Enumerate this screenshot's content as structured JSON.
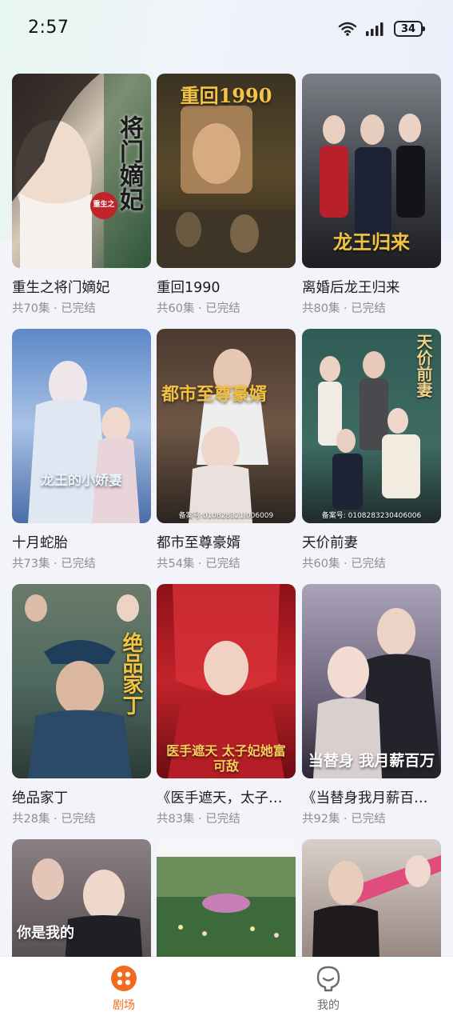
{
  "status_bar": {
    "time": "2:57",
    "battery": "34"
  },
  "dramas": [
    {
      "title": "重生之将门嫡妃",
      "episodes": "共70集",
      "status": "已完结",
      "poster_text": "将门嫡妃",
      "badge": "重生之"
    },
    {
      "title": "重回1990",
      "episodes": "共60集",
      "status": "已完结",
      "poster_text": "重回1990"
    },
    {
      "title": "离婚后龙王归来",
      "episodes": "共80集",
      "status": "已完结",
      "poster_text": "龙王归来"
    },
    {
      "title": "十月蛇胎",
      "episodes": "共73集",
      "status": "已完结",
      "poster_text": "龙王的小娇妻"
    },
    {
      "title": "都市至尊豪婿",
      "episodes": "共54集",
      "status": "已完结",
      "poster_text": "都市至尊豪婿",
      "record": "备案号:010828321l006009"
    },
    {
      "title": "天价前妻",
      "episodes": "共60集",
      "status": "已完结",
      "poster_text": "天价前妻",
      "record": "备案号: 0108283230406006"
    },
    {
      "title": "绝品家丁",
      "episodes": "共28集",
      "status": "已完结",
      "poster_text": "绝品家丁"
    },
    {
      "title": "《医手遮天，太子妃她富可敌国》",
      "episodes": "共83集",
      "status": "已完结",
      "poster_text": "医手遮天 太子妃她富可敌"
    },
    {
      "title": "《当替身我月薪百万》",
      "episodes": "共92集",
      "status": "已完结",
      "poster_text": "当替身 我月薪百万"
    },
    {
      "title": "",
      "episodes": "",
      "status": "",
      "poster_text": "你是我的"
    },
    {
      "title": "",
      "episodes": "",
      "status": "",
      "poster_text": ""
    },
    {
      "title": "",
      "episodes": "",
      "status": "",
      "poster_text": ""
    }
  ],
  "meta_separator": " · ",
  "tabbar": {
    "tabs": [
      {
        "label": "剧场",
        "icon": "theater-icon",
        "active": true,
        "color": "#f26a1b"
      },
      {
        "label": "我的",
        "icon": "profile-icon",
        "active": false,
        "color": "#6b6b6b"
      }
    ]
  },
  "colors": {
    "accent": "#f26a1b",
    "meta_text": "#8d8d93",
    "title_text": "#1c1c1c"
  }
}
